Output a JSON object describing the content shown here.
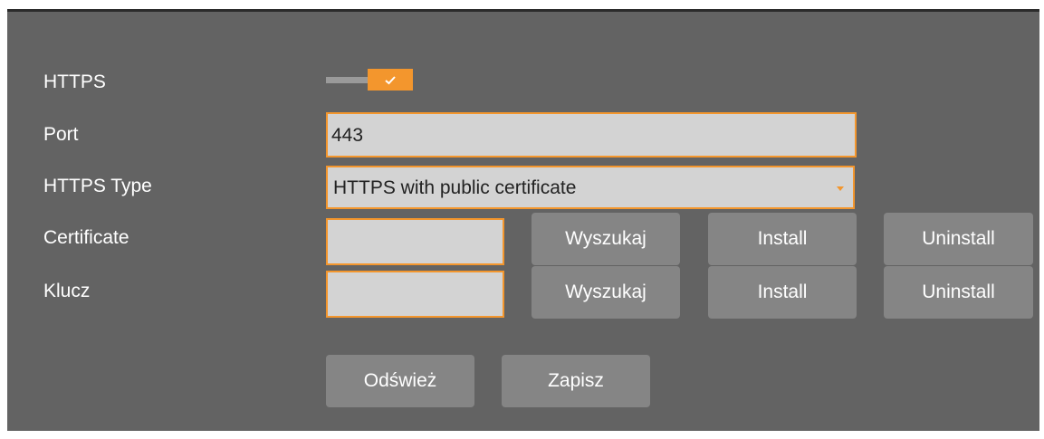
{
  "form": {
    "https": {
      "label": "HTTPS",
      "enabled": true
    },
    "port": {
      "label": "Port",
      "value": "443"
    },
    "https_type": {
      "label": "HTTPS Type",
      "selected": "HTTPS with public certificate"
    },
    "certificate": {
      "label": "Certificate",
      "value": "",
      "search_label": "Wyszukaj",
      "install_label": "Install",
      "uninstall_label": "Uninstall"
    },
    "key": {
      "label": "Klucz",
      "value": "",
      "search_label": "Wyszukaj",
      "install_label": "Install",
      "uninstall_label": "Uninstall"
    }
  },
  "actions": {
    "refresh_label": "Odśwież",
    "save_label": "Zapisz"
  },
  "colors": {
    "panel": "#636363",
    "accent": "#f3962d",
    "button": "#858585",
    "field": "#d3d3d3"
  },
  "icons": {
    "toggle_check": "checkmark-icon",
    "select_arrow": "caret-down-icon"
  }
}
